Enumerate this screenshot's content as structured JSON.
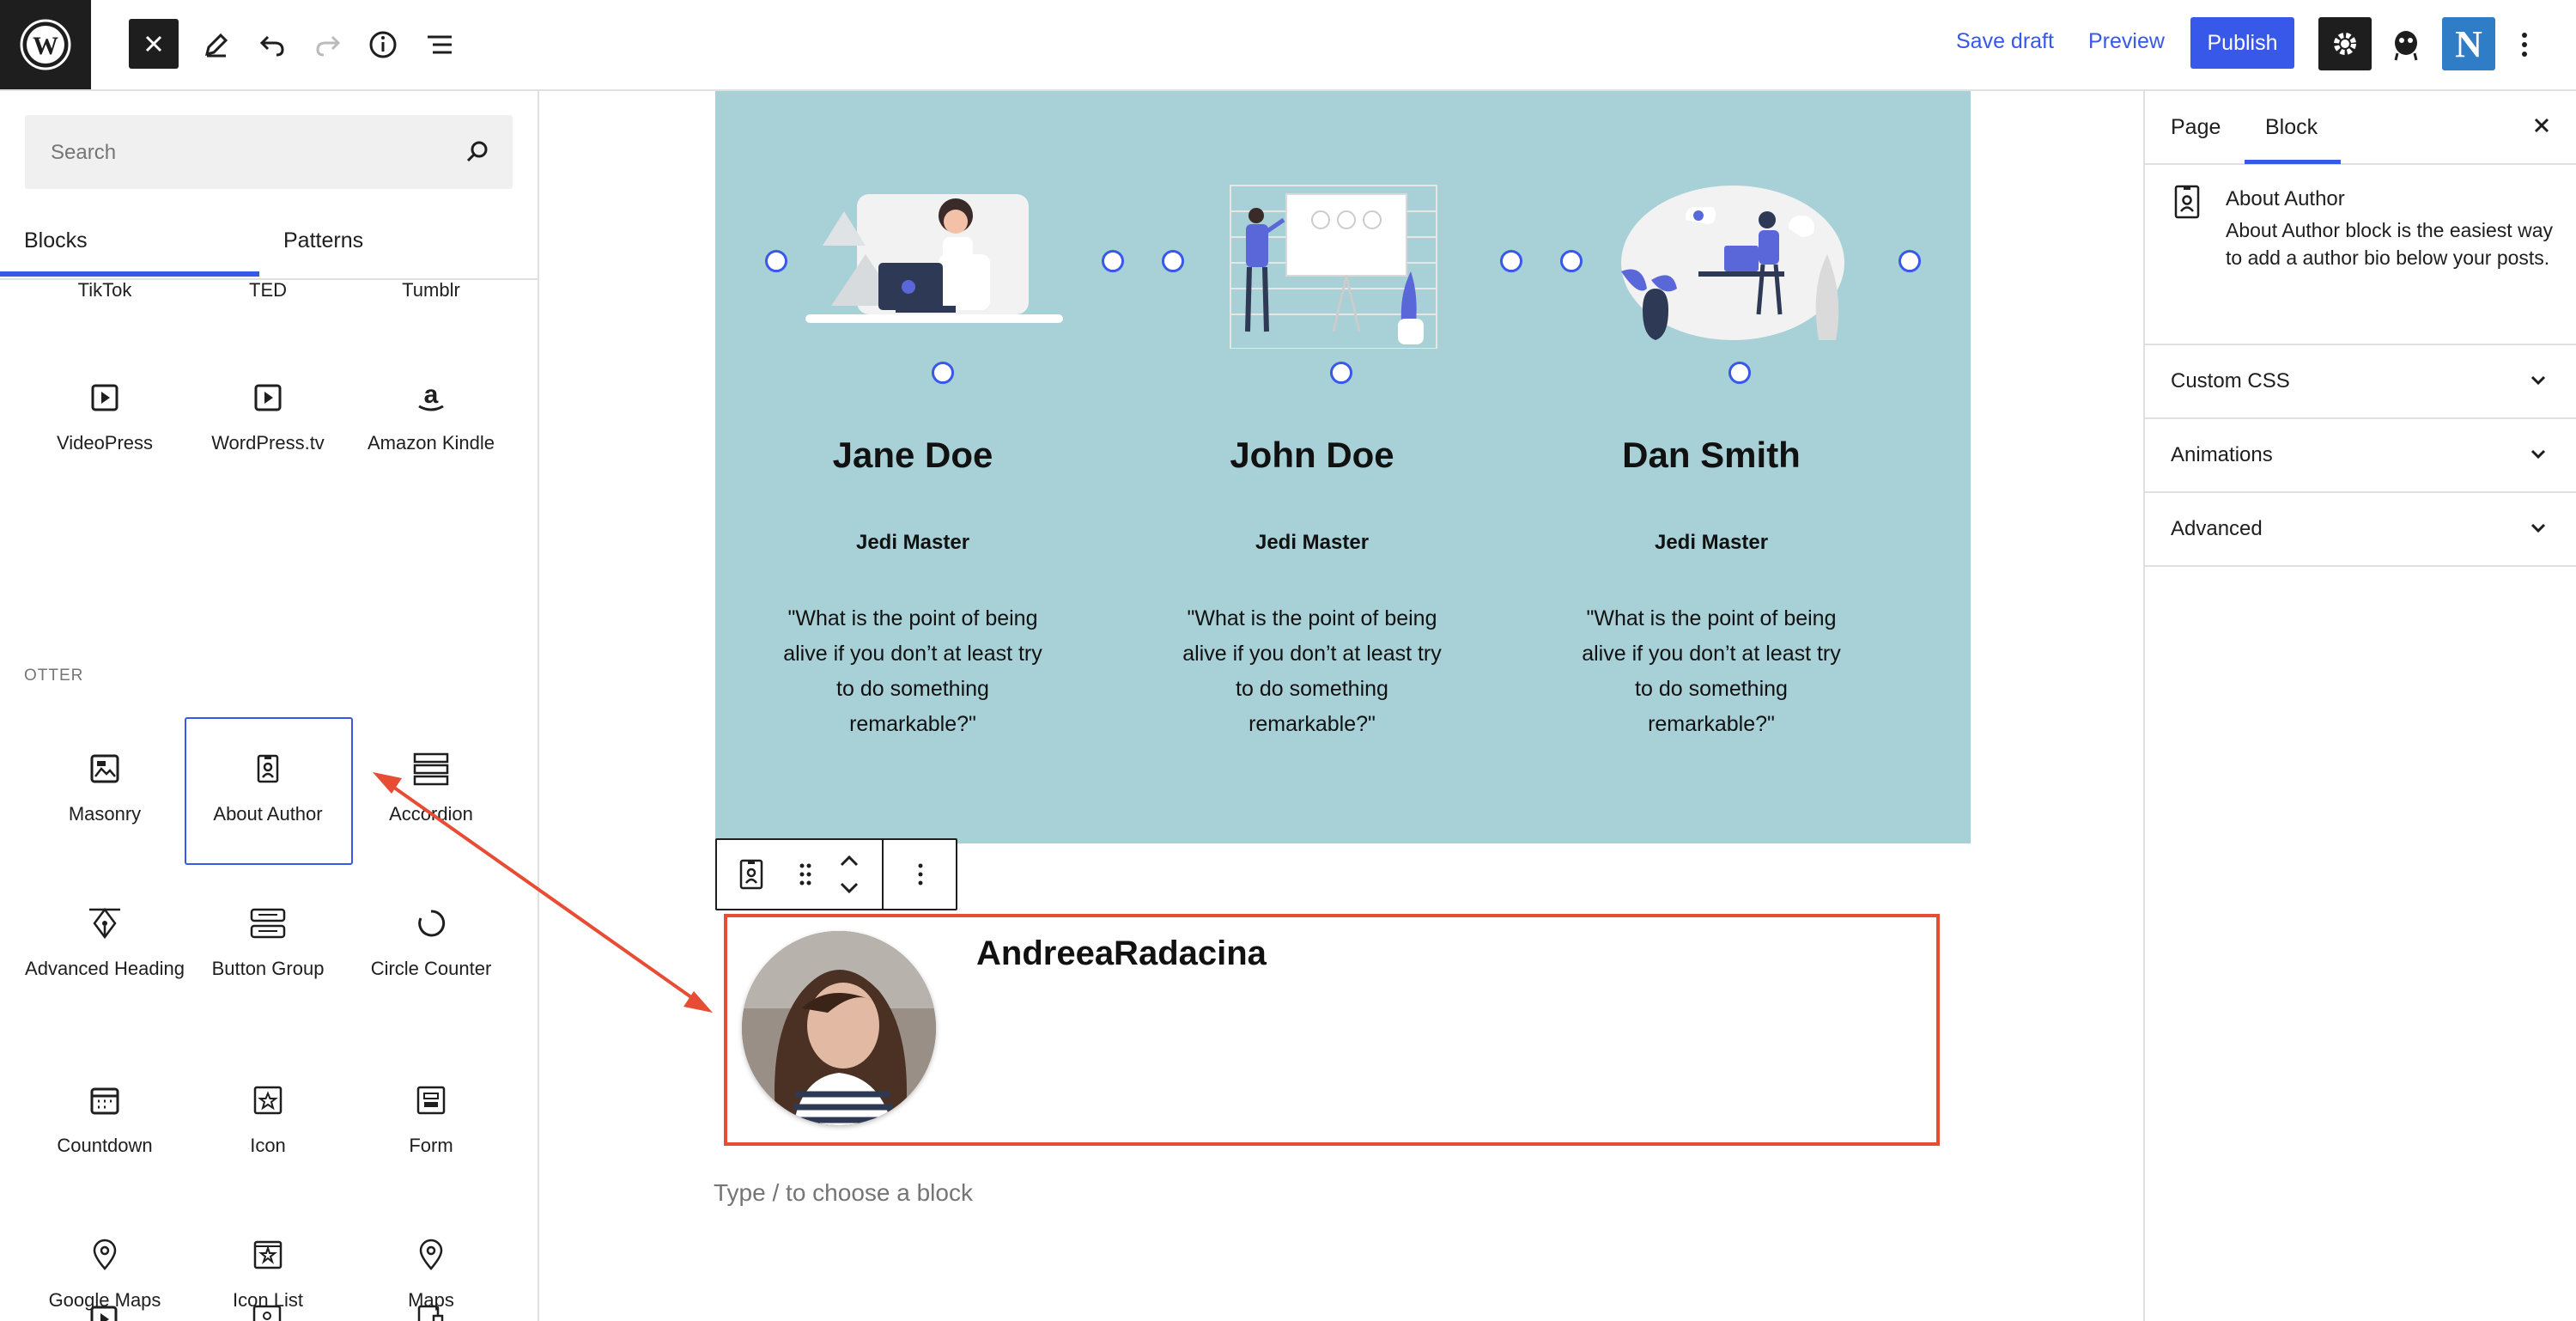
{
  "topbar": {
    "save_draft": "Save draft",
    "preview": "Preview",
    "publish": "Publish",
    "brand_letter": "N",
    "accent": "#3858e9"
  },
  "inserter": {
    "search_placeholder": "Search",
    "tabs": [
      "Blocks",
      "Patterns"
    ],
    "embeds_partial": [
      {
        "label": "TikTok"
      },
      {
        "label": "TED"
      },
      {
        "label": "Tumblr"
      }
    ],
    "embeds": [
      {
        "label": "VideoPress",
        "icon": "video-icon"
      },
      {
        "label": "WordPress.tv",
        "icon": "video-icon"
      },
      {
        "label": "Amazon Kindle",
        "icon": "amazon-icon"
      }
    ],
    "category": "OTTER",
    "otter_blocks": [
      {
        "label": "Masonry",
        "icon": "gallery-icon"
      },
      {
        "label": "About Author",
        "icon": "id-badge-icon"
      },
      {
        "label": "Accordion",
        "icon": "accordion-icon"
      },
      {
        "label": "Advanced Heading",
        "icon": "pen-nib-icon"
      },
      {
        "label": "Button Group",
        "icon": "button-group-icon"
      },
      {
        "label": "Circle Counter",
        "icon": "circle-counter-icon"
      },
      {
        "label": "Countdown",
        "icon": "calendar-icon"
      },
      {
        "label": "Icon",
        "icon": "star-icon"
      },
      {
        "label": "Form",
        "icon": "form-icon"
      },
      {
        "label": "Google Maps",
        "icon": "map-pin-icon"
      },
      {
        "label": "Icon List",
        "icon": "icon-list-icon"
      },
      {
        "label": "Maps",
        "icon": "map-pin-icon"
      }
    ]
  },
  "canvas": {
    "team_bg": "#a7d0d7",
    "members": [
      {
        "name": "Jane Doe",
        "role": "Jedi Master",
        "quote": "\"What is the point of being alive if you don’t at least try to do something remarkable?\""
      },
      {
        "name": "John Doe",
        "role": "Jedi Master",
        "quote": "\"What is the point of being alive if you don’t at least try to do something remarkable?\""
      },
      {
        "name": "Dan Smith",
        "role": "Jedi Master",
        "quote": "\"What is the point of being alive if you don’t at least try to do something remarkable?\""
      }
    ],
    "author": {
      "name": "AndreeaRadacina"
    },
    "append_hint": "Type / to choose a block",
    "annotation_color": "#e74c34"
  },
  "sidebar": {
    "tabs": [
      "Page",
      "Block"
    ],
    "block_card": {
      "title": "About Author",
      "description": "About Author block is the easiest way to add a author bio below your posts."
    },
    "panels": [
      "Custom CSS",
      "Animations",
      "Advanced"
    ]
  }
}
